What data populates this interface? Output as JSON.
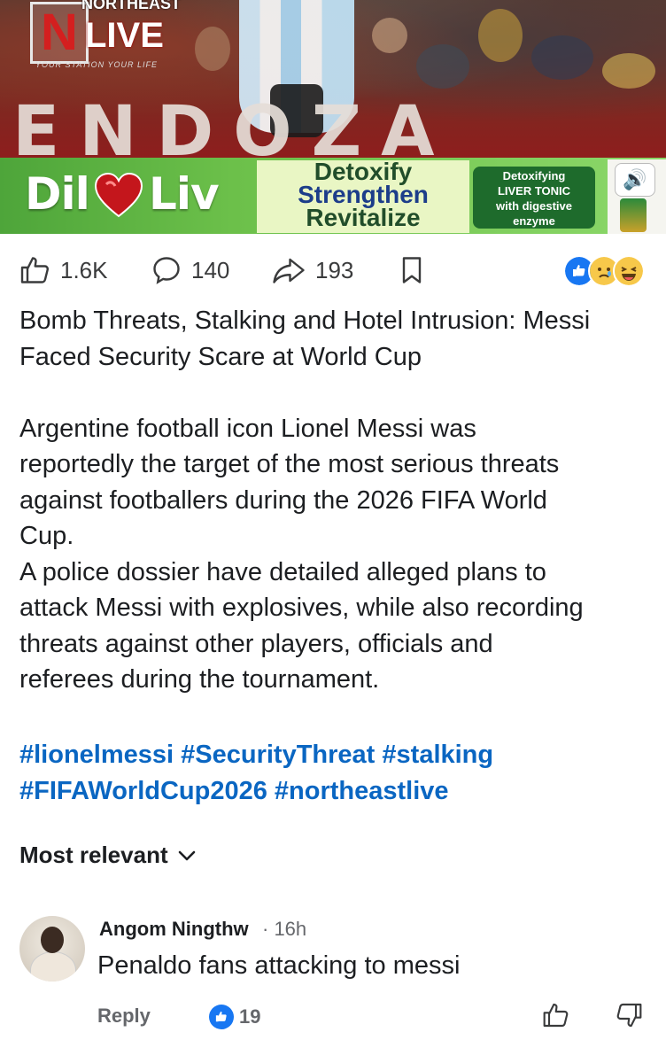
{
  "hero": {
    "logo_top": "NORTHEAST",
    "logo_letter": "N",
    "logo_word": "LIVE",
    "logo_tagline": "YOUR STATION YOUR LIFE",
    "overlay_text": "ENDOZA"
  },
  "ad": {
    "brand_left": "Dil",
    "brand_right": "Liv",
    "lines": [
      "Detoxify",
      "Strengthen",
      "Revitalize"
    ],
    "pill": [
      "Detoxifying",
      "LIVER TONIC",
      "with digestive",
      "enzyme"
    ]
  },
  "actions": {
    "likes": "1.6K",
    "comments": "140",
    "shares": "193"
  },
  "post": {
    "title_lines": [
      "Bomb Threats, Stalking and Hotel Intrusion: Messi",
      "Faced Security Scare at World Cup"
    ],
    "body_lines": [
      "Argentine football icon Lionel Messi was",
      "reportedly the target of the most serious threats",
      "against footballers during the 2026 FIFA World",
      "Cup.",
      "A police dossier have detailed alleged plans to",
      "attack Messi with explosives, while also recording",
      "threats against other players, officials and",
      "referees during the tournament."
    ],
    "hashtag_lines": [
      "#lionelmessi #SecurityThreat #stalking",
      "#FIFAWorldCup2026 #northeastlive"
    ]
  },
  "comments": {
    "sort_label": "Most relevant",
    "items": [
      {
        "author": "Angom Ningthw",
        "time": "· 16h",
        "text": "Penaldo fans attacking to messi",
        "reply_label": "Reply",
        "like_count": "19"
      }
    ]
  },
  "colors": {
    "link": "#0a66c2",
    "like_blue": "#1877f2",
    "text": "#1c1e21",
    "muted": "#65676b"
  }
}
